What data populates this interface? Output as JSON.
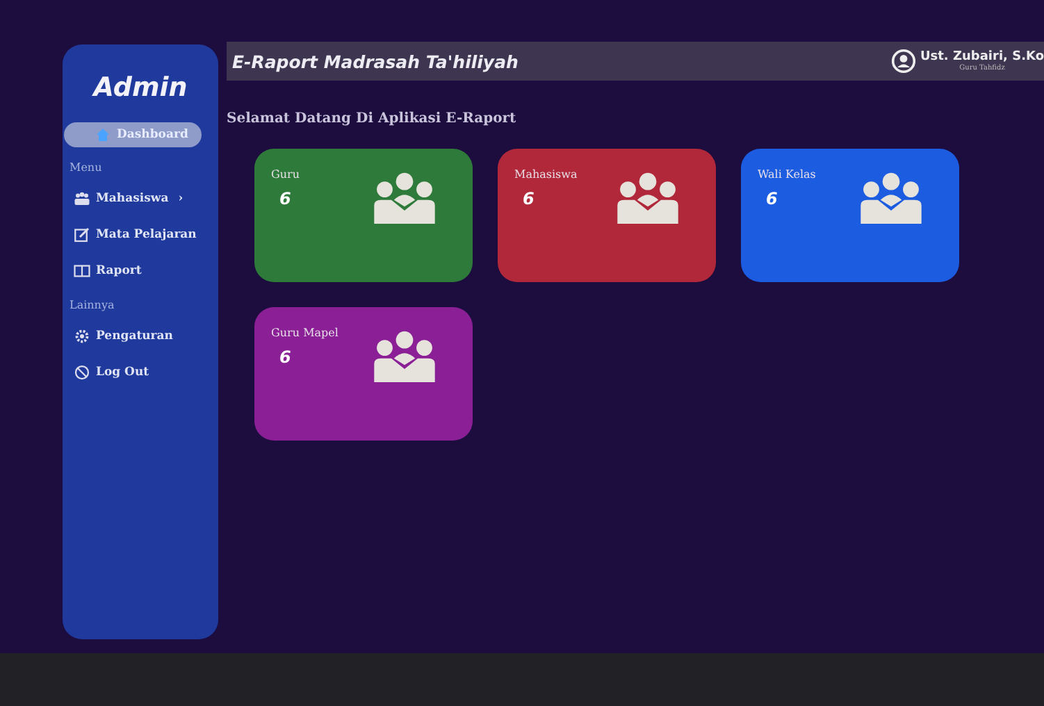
{
  "sidebar": {
    "brand": "Admin",
    "items": [
      {
        "kind": "link",
        "label": "Dashboard",
        "selected": true
      },
      {
        "kind": "section",
        "label": "Menu"
      },
      {
        "kind": "link",
        "label": "Mahasiswa",
        "chevron": "›",
        "selected": false
      },
      {
        "kind": "link",
        "label": "Mata Pelajaran",
        "selected": false
      },
      {
        "kind": "link",
        "label": "Raport",
        "selected": false
      },
      {
        "kind": "section",
        "label": "Lainnya"
      },
      {
        "kind": "link",
        "label": "Pengaturan",
        "selected": false
      },
      {
        "kind": "link",
        "label": "Log Out",
        "selected": false
      }
    ]
  },
  "header": {
    "title": "E-Raport Madrasah Ta'hiliyah",
    "user_name": "Ust. Zubairi, S.Ko",
    "user_role": "Guru Tahfidz"
  },
  "welcome": "Selamat Datang Di Aplikasi E-Raport",
  "cards": [
    {
      "label": "Guru",
      "count": "6",
      "color": "#2e7a3a"
    },
    {
      "label": "Mahasiswa",
      "count": "6",
      "color": "#b0283a"
    },
    {
      "label": "Wali Kelas",
      "count": "6",
      "color": "#1c5ce0"
    },
    {
      "label": "Guru Mapel",
      "count": "6",
      "color": "#8a1f96"
    }
  ]
}
